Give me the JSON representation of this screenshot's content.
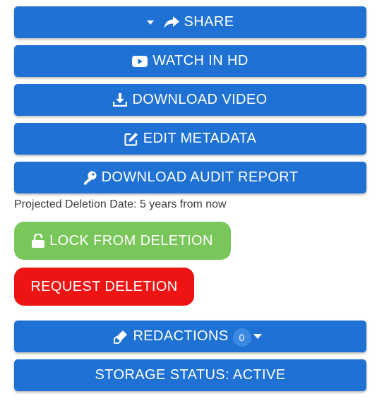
{
  "colors": {
    "primary_button": "#1f72d3",
    "lock_button": "#79c65a",
    "delete_button": "#ee1414",
    "badge": "#3c89e3",
    "note_text": "#3b3b3b"
  },
  "buttons": {
    "share": {
      "label": "SHARE",
      "icons": [
        "caret-down-icon",
        "share-arrow-icon"
      ]
    },
    "watch_hd": {
      "label": "WATCH IN HD",
      "icon": "youtube-play-icon"
    },
    "download_video": {
      "label": "DOWNLOAD VIDEO",
      "icon": "download-icon"
    },
    "edit_metadata": {
      "label": "EDIT METADATA",
      "icon": "edit-square-icon"
    },
    "download_audit": {
      "label": "DOWNLOAD AUDIT REPORT",
      "icon": "key-icon"
    },
    "lock": {
      "label": "LOCK FROM DELETION",
      "icon": "unlock-icon"
    },
    "request_deletion": {
      "label": "REQUEST DELETION"
    },
    "redactions": {
      "label": "REDACTIONS",
      "badge": "0",
      "icons": [
        "eraser-icon",
        "caret-down-icon"
      ]
    },
    "storage_status": {
      "label": "STORAGE STATUS: ACTIVE"
    }
  },
  "deletion_note": "Projected Deletion Date: 5 years from now"
}
